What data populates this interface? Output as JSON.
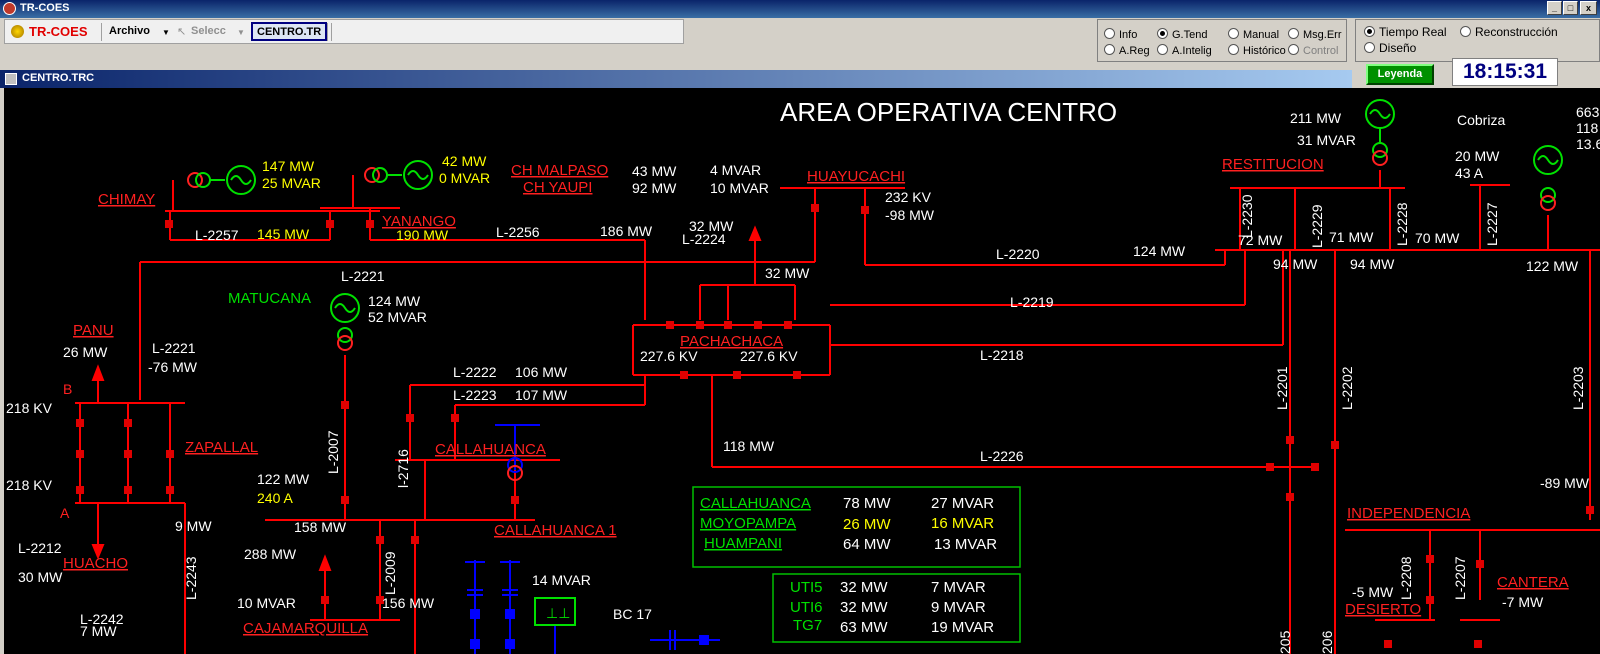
{
  "window": {
    "title": "TR-COES"
  },
  "toolbar": {
    "logo": "TR-COES",
    "archivo": "Archivo",
    "selecc": "Selecc",
    "tab": "CENTRO.TR"
  },
  "radios": {
    "info": "Info",
    "gtend": "G.Tend",
    "manual": "Manual",
    "msgerr": "Msg.Err",
    "areg": "A.Reg",
    "aintelig": "A.Intelig",
    "historico": "Histórico",
    "control": "Control",
    "tiempo_real": "Tiempo Real",
    "reconstruccion": "Reconstrucción",
    "diseno": "Diseño"
  },
  "leyenda": "Leyenda",
  "clock": "18:15:31",
  "child_window": {
    "title": "CENTRO.TRC"
  },
  "diagram": {
    "title": "AREA OPERATIVA CENTRO",
    "stations": {
      "chimay": "CHIMAY",
      "yanango": "YANANGO",
      "ch_malpaso": "CH MALPASO",
      "ch_yaupi": "CH YAUPI",
      "huayucachi": "HUAYUCACHI",
      "restitucion": "RESTITUCION",
      "cobriza": "Cobriza",
      "matucana": "MATUCANA",
      "panu": "PANU",
      "pachachaca": "PACHACHACA",
      "zapallal": "ZAPALLAL",
      "callahuanca": "CALLAHUANCA",
      "callahuanca1": "CALLAHUANCA 1",
      "huacho": "HUACHO",
      "cajamarquilla": "CAJAMARQUILLA",
      "independencia": "INDEPENDENCIA",
      "cantera": "CANTERA",
      "desierto": "DESIERTO"
    },
    "values": {
      "chimay_mw": "147 MW",
      "chimay_mvar": "25 MVAR",
      "yanango_mw": "42 MW",
      "yanango_mvar": "0 MVAR",
      "malpaso_mw": "43 MW",
      "yaupi_mw": "92 MW",
      "malpaso_mvar": "4 MVAR",
      "yaupi_mvar": "10 MVAR",
      "huay_kv": "232 KV",
      "huay_mw": "-98 MW",
      "l2257_mw": "145 MW",
      "yanango_190": "190 MW",
      "l2256_mw": "186 MW",
      "l2224_mw": "32 MW",
      "l2224_mw2": "32 MW",
      "matucana_mw": "124 MW",
      "matucana_mvar": "52 MVAR",
      "panu_mw": "26 MW",
      "l2221_mw": "-76 MW",
      "pach_kv1": "227.6 KV",
      "pach_kv2": "227.6 KV",
      "l2222_mw": "106 MW",
      "l2223_mw": "107 MW",
      "kv218a": "218 KV",
      "kv218b": "218 KV",
      "cal_122": "122 MW",
      "cal_240": "240 A",
      "mw9": "9 MW",
      "mw158": "158 MW",
      "mw288": "288 MW",
      "mw30": "30 MW",
      "mvar10": "10 MVAR",
      "mw156": "156 MW",
      "mw7": "7 MW",
      "mvar14": "14 MVAR",
      "bc17": "BC 17",
      "l2226_mw": "118 MW",
      "l2220_mw": "124 MW",
      "rest_211": "211 MW",
      "rest_31": "31 MVAR",
      "cob_20": "20 MW",
      "cob_43": "43 A",
      "mw72": "72 MW",
      "mw71": "71 MW",
      "mw70": "70 MW",
      "mw94a": "94 MW",
      "mw94b": "94 MW",
      "mw122": "122 MW",
      "mw_89": "-89 MW",
      "mw_5": "-5 MW",
      "mw_7": "-7 MW",
      "edge1": "663",
      "edge2": "118",
      "edge3": "13.6",
      "b_label": "B",
      "a_label": "A"
    },
    "lines": {
      "l2257": "L-2257",
      "l2256": "L-2256",
      "l2224": "L-2224",
      "l2221a": "L-2221",
      "l2221b": "L-2221",
      "l2220": "L-2220",
      "l2219": "L-2219",
      "l2218": "L-2218",
      "l2222": "L-2222",
      "l2223": "L-2223",
      "l2007": "L-2007",
      "l2716": "l-2716",
      "l2212": "L-2212",
      "l2243": "L-2243",
      "l2242": "L-2242",
      "l2009": "L-2009",
      "l2226": "L-2226",
      "l2230": "L-2230",
      "l2229": "L-2229",
      "l2228": "L-2228",
      "l2227": "L-2227",
      "l2201": "L-2201",
      "l2202": "L-2202",
      "l2203": "L-2203",
      "l2208": "L-2208",
      "l2207": "L-2207",
      "l205": "205",
      "l206": "206"
    },
    "table1": [
      {
        "name": "CALLAHUANCA",
        "mw": "78 MW",
        "mvar": "27 MVAR",
        "mw_color": "#ffffff"
      },
      {
        "name": "MOYOPAMPA",
        "mw": "26 MW",
        "mvar": "16 MVAR",
        "mw_color": "#ffff00"
      },
      {
        "name": "HUAMPANI",
        "mw": "64 MW",
        "mvar": "13 MVAR",
        "mw_color": "#ffffff"
      }
    ],
    "table2": [
      {
        "name": "UTI5",
        "mw": "32 MW",
        "mvar": "7 MVAR"
      },
      {
        "name": "UTI6",
        "mw": "32 MW",
        "mvar": "9 MVAR"
      },
      {
        "name": "TG7",
        "mw": "63 MW",
        "mvar": "19 MVAR"
      }
    ]
  },
  "colors": {
    "line": "#ff0000",
    "station": "#ff2020",
    "value": "#ffffff",
    "gen_value": "#ffff00",
    "gen": "#00e000",
    "capacitor": "#0000ff"
  }
}
